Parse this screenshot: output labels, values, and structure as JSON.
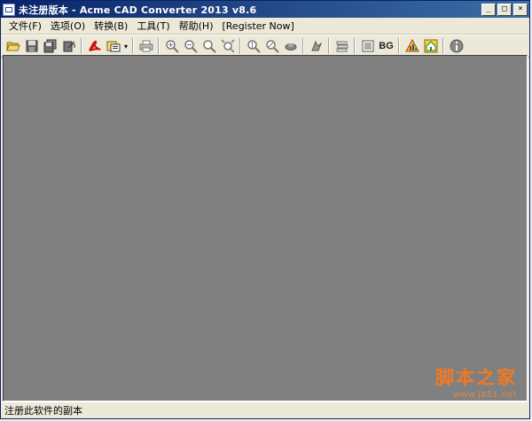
{
  "window": {
    "title": "未注册版本 - Acme CAD Converter 2013 v8.6",
    "controls": {
      "minimize": "_",
      "maximize": "□",
      "close": "×"
    }
  },
  "menubar": {
    "items": [
      {
        "label": "文件(F)"
      },
      {
        "label": "选项(O)"
      },
      {
        "label": "转换(B)"
      },
      {
        "label": "工具(T)"
      },
      {
        "label": "帮助(H)"
      },
      {
        "label": "[Register Now]"
      }
    ]
  },
  "toolbar": {
    "bg_label": "BG",
    "dropdown_arrow": "▾",
    "icons": [
      "open-folder-icon",
      "save-icon",
      "save-all-icon",
      "export-icon",
      "acrobat-icon",
      "batch-convert-icon",
      "print-icon",
      "zoom-in-icon",
      "zoom-out-icon",
      "zoom-window-icon",
      "zoom-extents-icon",
      "zoom-realtime-icon",
      "pan-icon",
      "layers-icon",
      "text-style-icon",
      "background-icon",
      "bg-color-button",
      "chart-icon",
      "home-icon",
      "info-icon"
    ]
  },
  "statusbar": {
    "text": "注册此软件的副本"
  },
  "watermark": {
    "title": "脚本之家",
    "url": "www.jb51.net"
  },
  "colors": {
    "canvas": "#808080",
    "titlebar_start": "#0a246a",
    "titlebar_end": "#3a6ea5",
    "watermark": "#f07a22"
  }
}
